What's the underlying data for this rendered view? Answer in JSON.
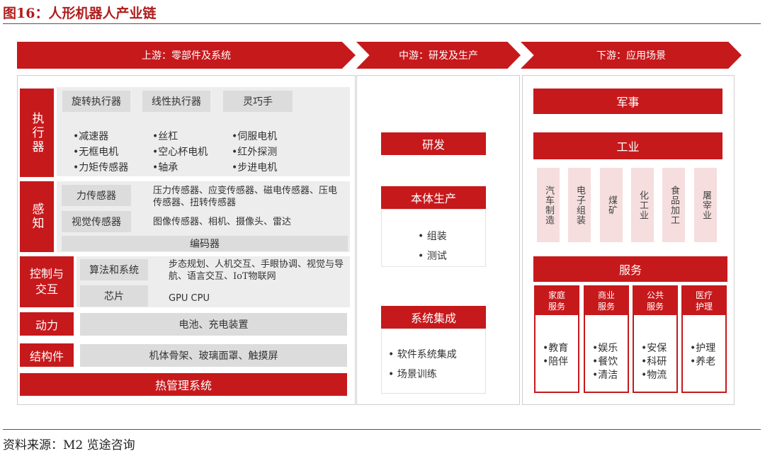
{
  "title": "图16：人形机器人产业链",
  "source": "资料来源：M2 览途咨询",
  "headers": {
    "upstream": "上游：零部件及系统",
    "midstream": "中游：研发及生产",
    "downstream": "下游：应用场景"
  },
  "upstream": {
    "executor": {
      "label": "执行器",
      "chips": [
        "旋转执行器",
        "线性执行器",
        "灵巧手"
      ],
      "items": [
        "•减速器",
        "•丝杠",
        "•伺服电机",
        "•无框电机",
        "•空心杯电机",
        "•红外探测",
        "•力矩传感器",
        "•轴承",
        "•步进电机"
      ]
    },
    "sensing": {
      "label": "感知",
      "force_label": "力传感器",
      "force_text": "压力传感器、应变传感器、磁电传感器、压电传感器、扭转传感器",
      "vision_label": "视觉传感器",
      "vision_text": "图像传感器、相机、摄像头、雷达",
      "encoder": "编码器"
    },
    "control": {
      "label": "控制与交互",
      "algo_label": "算法和系统",
      "algo_text": "步态规划、人机交互、手眼协调、视觉与导航、语言交互、IoT物联网",
      "chip_label": "芯片",
      "chip_text": "GPU CPU"
    },
    "power": {
      "label": "动力",
      "text": "电池、充电装置"
    },
    "structure": {
      "label": "结构件",
      "text": "机体骨架、玻璃面罩、触摸屏"
    },
    "thermal": "热管理系统"
  },
  "midstream": {
    "rd": "研发",
    "production": {
      "label": "本体生产",
      "items": [
        "•  组装",
        "•  测试"
      ]
    },
    "integration": {
      "label": "系统集成",
      "items": [
        "•  软件系统集成",
        "•  场景训练"
      ]
    }
  },
  "downstream": {
    "military": "军事",
    "industry": {
      "label": "工业",
      "items": [
        "汽车制造",
        "电子组装",
        "煤矿",
        "化工业",
        "食品加工",
        "屠宰业"
      ]
    },
    "service": {
      "label": "服务",
      "cols": [
        {
          "head": "家庭服务",
          "items": [
            "•教育",
            "•陪伴"
          ]
        },
        {
          "head": "商业服务",
          "items": [
            "•娱乐",
            "•餐饮",
            "•清洁"
          ]
        },
        {
          "head": "公共服务",
          "items": [
            "•安保",
            "•科研",
            "•物流"
          ]
        },
        {
          "head": "医疗护理",
          "items": [
            "•护理",
            "•养老"
          ]
        }
      ]
    }
  },
  "colors": {
    "accent": "#c6191c",
    "chip": "#dcdcdc",
    "panel": "#ededed",
    "soft": "#f6dede"
  }
}
